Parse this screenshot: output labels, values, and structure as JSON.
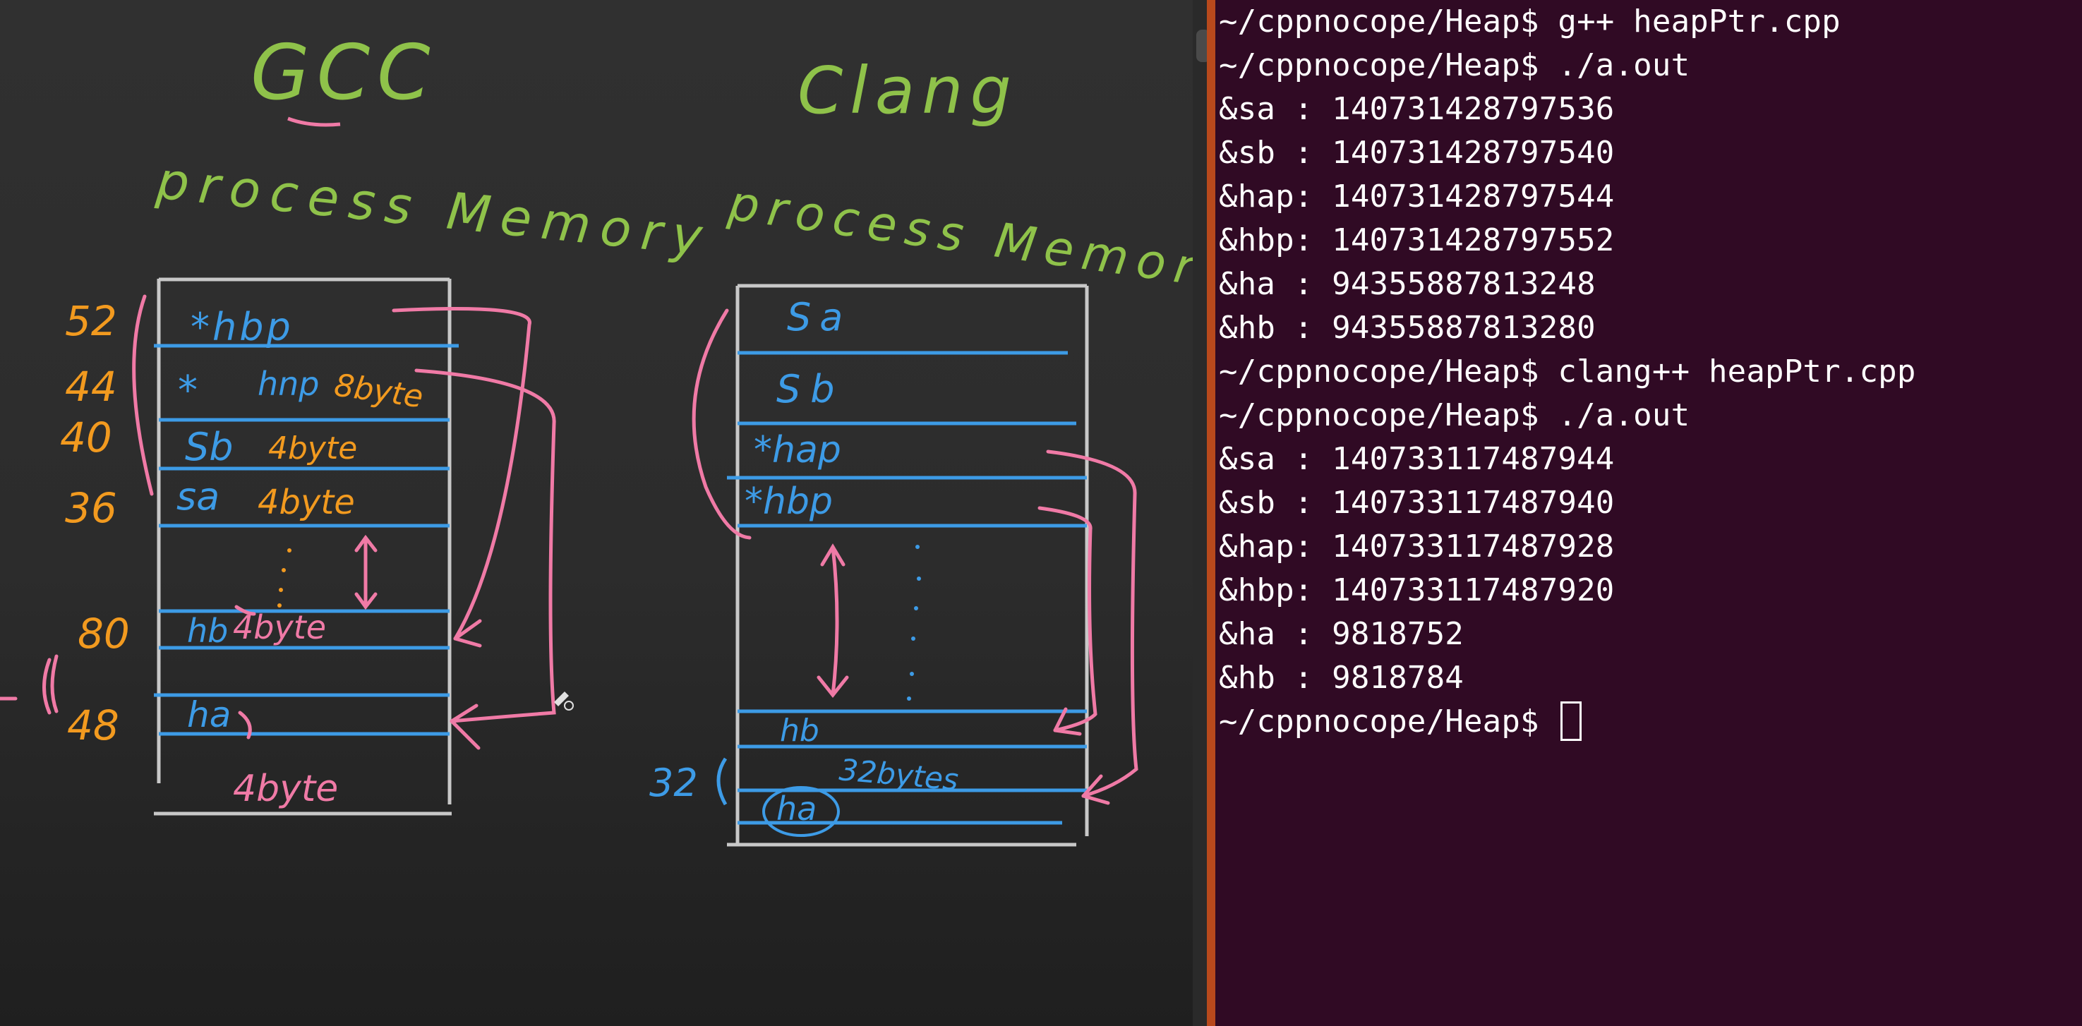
{
  "whiteboard": {
    "gcc": {
      "title": "GCC",
      "subtitle": "process Memory",
      "cells": [
        "*hbp",
        "*",
        "hnp",
        "8byte",
        "Sb",
        "4byte",
        "sa",
        "4byte",
        "hb",
        "4byte",
        "ha",
        "4byte"
      ],
      "left_labels": [
        "52",
        "44",
        "40",
        "36",
        "80",
        "48"
      ]
    },
    "clang": {
      "title": "Clang",
      "subtitle": "process Memory",
      "cells": [
        "Sa",
        "Sb",
        "*hap",
        "*hbp",
        "hb",
        "32bytes",
        "ha"
      ],
      "left_labels": [
        "32"
      ]
    },
    "colors": {
      "green": "#8fc24a",
      "blue": "#3d9be6",
      "orange": "#f29a1f",
      "pink": "#f07aa6",
      "outline": "#c8c8c8"
    }
  },
  "terminal": {
    "lines": [
      "~/cppnocope/Heap$ g++ heapPtr.cpp",
      "~/cppnocope/Heap$ ./a.out",
      "&sa : 140731428797536",
      "&sb : 140731428797540",
      "&hap: 140731428797544",
      "&hbp: 140731428797552",
      "&ha : 94355887813248",
      "&hb : 94355887813280",
      "~/cppnocope/Heap$ clang++ heapPtr.cpp",
      "~/cppnocope/Heap$ ./a.out",
      "&sa : 140733117487944",
      "&sb : 140733117487940",
      "&hap: 140733117487928",
      "&hbp: 140733117487920",
      "&ha : 9818752",
      "&hb : 9818784"
    ],
    "prompt": "~/cppnocope/Heap$ ",
    "colors": {
      "background": "#300a24",
      "text": "#ffffff",
      "edge": "#b8491c"
    }
  }
}
